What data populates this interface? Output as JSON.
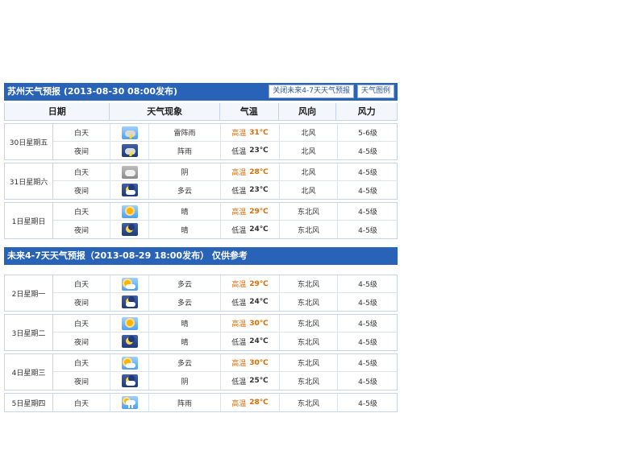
{
  "forecast1": {
    "title": "苏州天气预报 (2013-08-30  08:00发布)",
    "btn_close": "关闭未来4-7天天气预报",
    "btn_legend": "天气图例"
  },
  "headers": {
    "date": "日期",
    "weather": "天气现象",
    "temp": "气温",
    "wind_dir": "风向",
    "wind_force": "风力"
  },
  "days1": [
    {
      "date": "30日星期五",
      "rows": [
        {
          "period": "白天",
          "icon": "thunderstorm-day-icon",
          "desc": "雷阵雨",
          "temp_label": "高温",
          "temp": "31℃",
          "dir": "北风",
          "force": "5-6级",
          "hi": true
        },
        {
          "period": "夜间",
          "icon": "thunderstorm-night-icon",
          "desc": "阵雨",
          "temp_label": "低温",
          "temp": "23℃",
          "dir": "北风",
          "force": "4-5级",
          "hi": false
        }
      ]
    },
    {
      "date": "31日星期六",
      "rows": [
        {
          "period": "白天",
          "icon": "overcast-icon",
          "desc": "阴",
          "temp_label": "高温",
          "temp": "28℃",
          "dir": "北风",
          "force": "4-5级",
          "hi": true
        },
        {
          "period": "夜间",
          "icon": "partly-cloudy-night-icon",
          "desc": "多云",
          "temp_label": "低温",
          "temp": "23℃",
          "dir": "北风",
          "force": "4-5级",
          "hi": false
        }
      ]
    },
    {
      "date": "1日星期日",
      "rows": [
        {
          "period": "白天",
          "icon": "sunny-icon",
          "desc": "晴",
          "temp_label": "高温",
          "temp": "29℃",
          "dir": "东北风",
          "force": "4-5级",
          "hi": true
        },
        {
          "period": "夜间",
          "icon": "clear-night-icon",
          "desc": "晴",
          "temp_label": "低温",
          "temp": "24℃",
          "dir": "东北风",
          "force": "4-5级",
          "hi": false
        }
      ]
    }
  ],
  "forecast2": {
    "title": "未来4-7天天气预报（2013-08-29 18:00发布）    仅供参考"
  },
  "days2": [
    {
      "date": "2日星期一",
      "rows": [
        {
          "period": "白天",
          "icon": "partly-cloudy-day-icon",
          "desc": "多云",
          "temp_label": "高温",
          "temp": "29℃",
          "dir": "东北风",
          "force": "4-5级",
          "hi": true
        },
        {
          "period": "夜间",
          "icon": "partly-cloudy-night-icon",
          "desc": "多云",
          "temp_label": "低温",
          "temp": "24℃",
          "dir": "东北风",
          "force": "4-5级",
          "hi": false
        }
      ]
    },
    {
      "date": "3日星期二",
      "rows": [
        {
          "period": "白天",
          "icon": "sunny-icon",
          "desc": "晴",
          "temp_label": "高温",
          "temp": "30℃",
          "dir": "东北风",
          "force": "4-5级",
          "hi": true
        },
        {
          "period": "夜间",
          "icon": "clear-night-icon",
          "desc": "晴",
          "temp_label": "低温",
          "temp": "24℃",
          "dir": "东北风",
          "force": "4-5级",
          "hi": false
        }
      ]
    },
    {
      "date": "4日星期三",
      "rows": [
        {
          "period": "白天",
          "icon": "partly-cloudy-day-icon",
          "desc": "多云",
          "temp_label": "高温",
          "temp": "30℃",
          "dir": "东北风",
          "force": "4-5级",
          "hi": true
        },
        {
          "period": "夜间",
          "icon": "overcast-night-icon",
          "desc": "阴",
          "temp_label": "低温",
          "temp": "25℃",
          "dir": "东北风",
          "force": "4-5级",
          "hi": false
        }
      ]
    },
    {
      "date": "5日星期四",
      "rows": [
        {
          "period": "白天",
          "icon": "shower-day-icon",
          "desc": "阵雨",
          "temp_label": "高温",
          "temp": "28℃",
          "dir": "东北风",
          "force": "4-5级",
          "hi": true
        }
      ]
    }
  ]
}
